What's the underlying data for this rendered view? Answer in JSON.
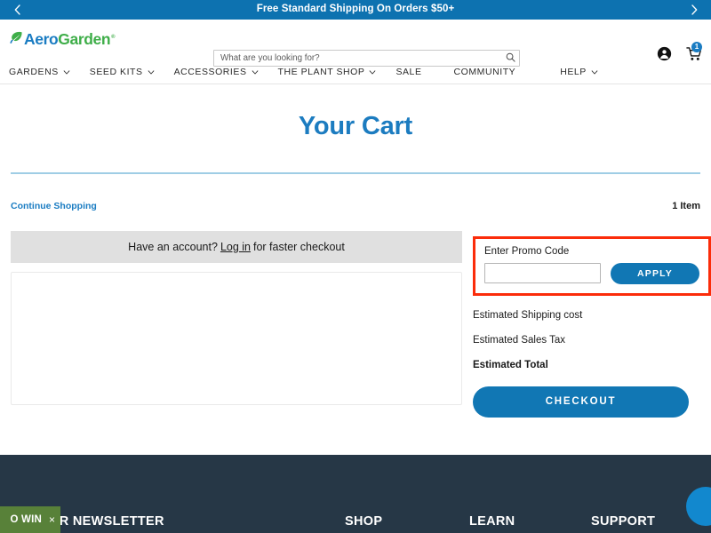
{
  "banner": {
    "text": "Free Standard Shipping On Orders $50+",
    "prev_label": "‹",
    "next_label": "›",
    "background": "#0d72b0"
  },
  "header": {
    "logo": {
      "aero": "Aero",
      "garden": "Garden",
      "trademark": "®",
      "aero_color": "#1a7cc2",
      "garden_color": "#3fae49"
    },
    "search": {
      "placeholder": "What are you looking for?",
      "value": "",
      "icon": "search-icon"
    },
    "account_icon": "account-icon",
    "cart_icon": "cart-icon",
    "cart_count": "1"
  },
  "nav": {
    "items": [
      {
        "label": "GARDENS",
        "has_dropdown": true
      },
      {
        "label": "SEED KITS",
        "has_dropdown": true
      },
      {
        "label": "ACCESSORIES",
        "has_dropdown": true
      },
      {
        "label": "THE PLANT SHOP",
        "has_dropdown": true
      },
      {
        "label": "SALE",
        "has_dropdown": false
      },
      {
        "label": "COMMUNITY",
        "has_dropdown": false
      },
      {
        "label": "HELP",
        "has_dropdown": true
      }
    ]
  },
  "cart": {
    "title": "Your Cart",
    "title_color": "#1c7cc0",
    "continue_shopping": "Continue Shopping",
    "item_count": "1 Item",
    "account_prompt": {
      "before": "Have an account?",
      "link": "Log in",
      "after": "for faster checkout"
    }
  },
  "promo": {
    "label": "Enter Promo Code",
    "input_value": "",
    "apply_label": "APPLY",
    "highlight_color": "#fb2c0a"
  },
  "summary": {
    "shipping_label": "Estimated Shipping cost",
    "tax_label": "Estimated Sales Tax",
    "total_label": "Estimated Total",
    "checkout_label": "CHECKOUT",
    "button_color": "#1177b4"
  },
  "footer": {
    "background": "#263746",
    "headings": {
      "newsletter": "UR NEWSLETTER",
      "shop": "SHOP",
      "learn": "LEARN",
      "support": "SUPPORT"
    },
    "win_tab": {
      "text": "O WIN",
      "close": "×",
      "color": "#588139"
    },
    "chat_icon": "chat-bubble-icon"
  }
}
